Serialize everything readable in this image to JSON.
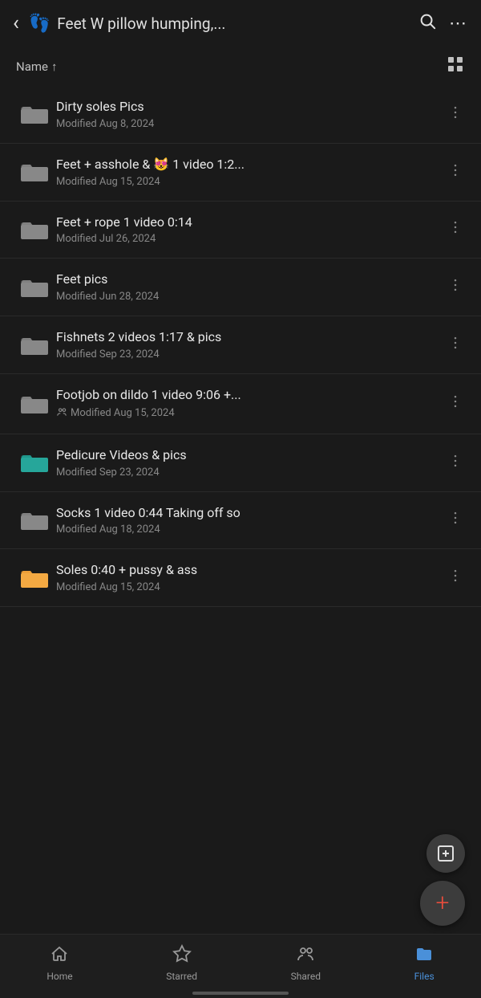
{
  "header": {
    "back_label": "‹",
    "folder_emoji": "👣",
    "title": "Feet   W pillow humping,...",
    "search_label": "⌕",
    "more_label": "···"
  },
  "sort_bar": {
    "sort_label": "Name",
    "sort_arrow": "↑",
    "grid_icon": "⊞"
  },
  "files": [
    {
      "name": "Dirty soles   Pics",
      "modified": "Modified Aug 8, 2024",
      "folder_color": "gray",
      "shared": false
    },
    {
      "name": "Feet + asshole & 😻   1 video   1:2...",
      "modified": "Modified Aug 15, 2024",
      "folder_color": "gray",
      "shared": false
    },
    {
      "name": "Feet + rope   1 video   0:14",
      "modified": "Modified Jul 26, 2024",
      "folder_color": "gray",
      "shared": false
    },
    {
      "name": "Feet pics",
      "modified": "Modified Jun 28, 2024",
      "folder_color": "gray",
      "shared": false
    },
    {
      "name": "Fishnets   2 videos   1:17   & pics",
      "modified": "Modified Sep 23, 2024",
      "folder_color": "gray",
      "shared": false
    },
    {
      "name": "Footjob on dildo   1 video   9:06   +...",
      "modified": "Modified Aug 15, 2024",
      "folder_color": "gray",
      "shared": true
    },
    {
      "name": "Pedicure   Videos & pics",
      "modified": "Modified Sep 23, 2024",
      "folder_color": "teal",
      "shared": false
    },
    {
      "name": "Socks   1 video   0:44   Taking off so",
      "modified": "Modified Aug 18, 2024",
      "folder_color": "gray",
      "shared": false
    },
    {
      "name": "Soles   0:40   + pussy & ass",
      "modified": "Modified Aug 15, 2024",
      "folder_color": "orange",
      "shared": false
    }
  ],
  "fab": {
    "secondary_icon": "⊟",
    "primary_icon": "+"
  },
  "bottom_nav": {
    "items": [
      {
        "label": "Home",
        "icon": "⌂",
        "active": false
      },
      {
        "label": "Starred",
        "icon": "☆",
        "active": false
      },
      {
        "label": "Shared",
        "icon": "👥",
        "active": false
      },
      {
        "label": "Files",
        "icon": "📁",
        "active": true
      }
    ]
  }
}
